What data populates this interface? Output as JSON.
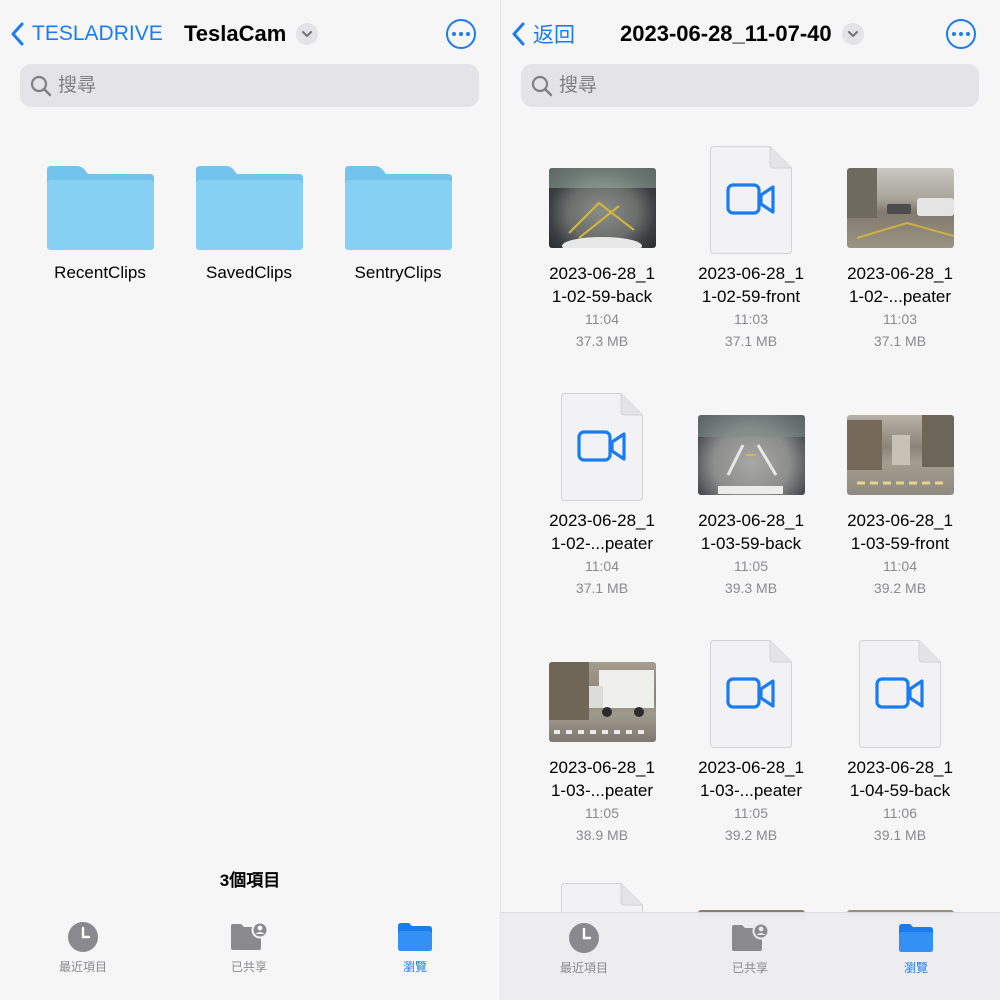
{
  "left": {
    "back_label": "TESLADRIVE",
    "title": "TeslaCam",
    "search_placeholder": "搜尋",
    "folders": [
      {
        "name": "RecentClips"
      },
      {
        "name": "SavedClips"
      },
      {
        "name": "SentryClips"
      }
    ],
    "item_count": "3個項目",
    "tabs": [
      {
        "label": "最近項目",
        "icon": "clock-icon"
      },
      {
        "label": "已共享",
        "icon": "shared-folder-icon"
      },
      {
        "label": "瀏覽",
        "icon": "folder-icon",
        "active": true
      }
    ]
  },
  "right": {
    "back_label": "返回",
    "title": "2023-06-28_11-07-40",
    "search_placeholder": "搜尋",
    "files": [
      {
        "line1": "2023-06-28_1",
        "line2": "1-02-59-back",
        "time": "11:04",
        "size": "37.3 MB",
        "thumb": "photo-fisheye"
      },
      {
        "line1": "2023-06-28_1",
        "line2": "1-02-59-front",
        "time": "11:03",
        "size": "37.1 MB",
        "thumb": "video-doc"
      },
      {
        "line1": "2023-06-28_1",
        "line2": "1-02-...peater",
        "time": "11:03",
        "size": "37.1 MB",
        "thumb": "photo-street-cars"
      },
      {
        "line1": "2023-06-28_1",
        "line2": "1-02-...peater",
        "time": "11:04",
        "size": "37.1 MB",
        "thumb": "video-doc"
      },
      {
        "line1": "2023-06-28_1",
        "line2": "1-03-59-back",
        "time": "11:05",
        "size": "39.3 MB",
        "thumb": "photo-fisheye-road"
      },
      {
        "line1": "2023-06-28_1",
        "line2": "1-03-59-front",
        "time": "11:04",
        "size": "39.2 MB",
        "thumb": "photo-city-street"
      },
      {
        "line1": "2023-06-28_1",
        "line2": "1-03-...peater",
        "time": "11:05",
        "size": "38.9 MB",
        "thumb": "photo-truck"
      },
      {
        "line1": "2023-06-28_1",
        "line2": "1-03-...peater",
        "time": "11:05",
        "size": "39.2 MB",
        "thumb": "video-doc"
      },
      {
        "line1": "2023-06-28_1",
        "line2": "1-04-59-back",
        "time": "11:06",
        "size": "39.1 MB",
        "thumb": "video-doc"
      }
    ],
    "tabs": [
      {
        "label": "最近項目",
        "icon": "clock-icon"
      },
      {
        "label": "已共享",
        "icon": "shared-folder-icon"
      },
      {
        "label": "瀏覽",
        "icon": "folder-icon",
        "active": true
      }
    ]
  },
  "colors": {
    "accent": "#1b7cf0",
    "folder": "#7ecbf2",
    "background": "#f6f6f6"
  }
}
